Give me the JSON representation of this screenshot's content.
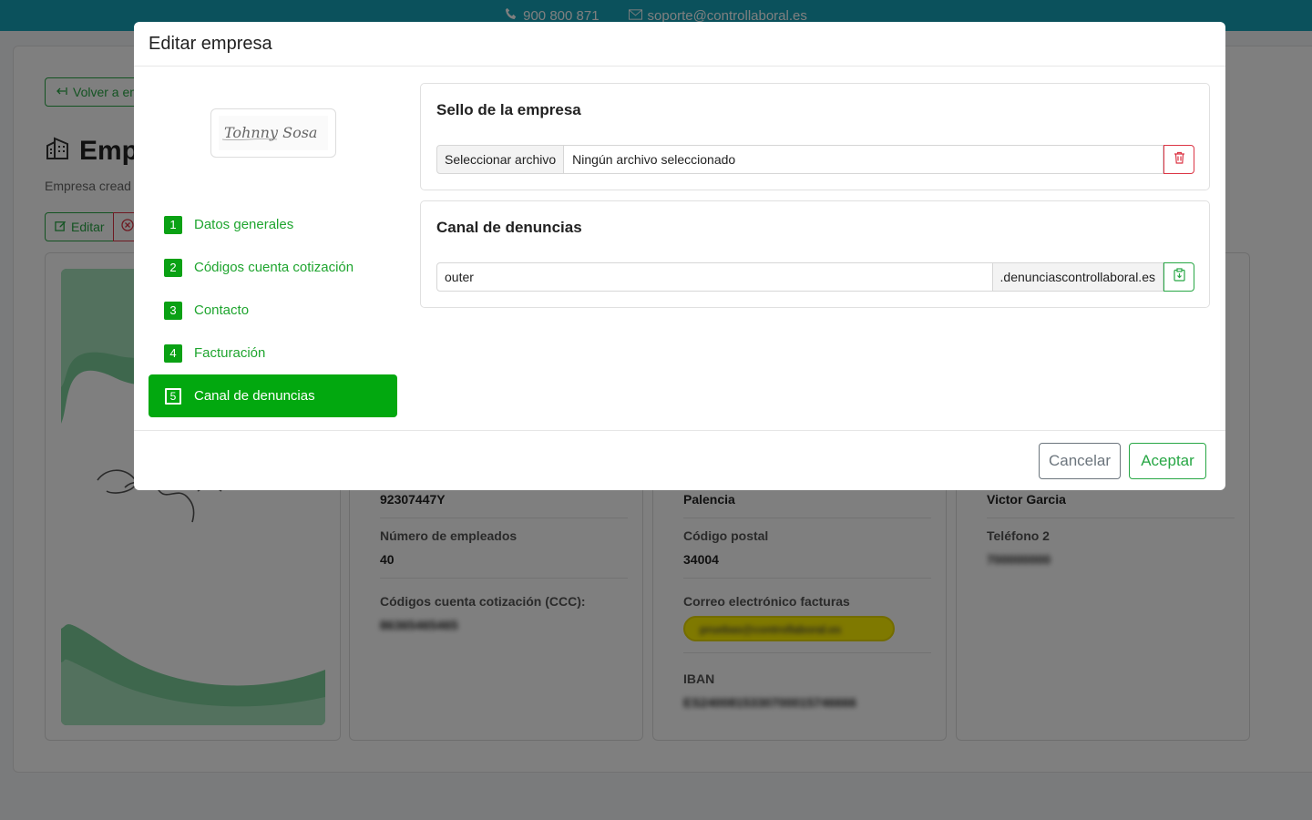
{
  "topbar": {
    "phone": "900 800 871",
    "email": "soporte@controllaboral.es"
  },
  "page": {
    "back_label": "Volver a em",
    "title": "Emp",
    "subtitle": "Empresa cread",
    "edit_label": "Editar"
  },
  "cards": {
    "c2": {
      "nif_value": "92307447Y",
      "employees_label": "Número de empleados",
      "employees_value": "40",
      "ccc_label": "Códigos cuenta cotización (CCC):",
      "ccc_value": "86365465465"
    },
    "c3": {
      "province_value": "Palencia",
      "postal_label": "Código postal",
      "postal_value": "34004",
      "invoice_email_label": "Correo electrónico facturas",
      "invoice_email_value": "pruebas@controllaboral.es",
      "iban_label": "IBAN",
      "iban_value": "ES2400815330700015746666"
    },
    "c4": {
      "contact_value": "Victor Garcia",
      "phone2_label": "Teléfono 2",
      "phone2_value": "700000000"
    }
  },
  "modal": {
    "title": "Editar empresa",
    "logo_text": "Tohnny Sosa",
    "steps": [
      {
        "num": "1",
        "label": "Datos generales",
        "active": false
      },
      {
        "num": "2",
        "label": "Códigos cuenta cotización",
        "active": false
      },
      {
        "num": "3",
        "label": "Contacto",
        "active": false
      },
      {
        "num": "4",
        "label": "Facturación",
        "active": false
      },
      {
        "num": "5",
        "label": "Canal de denuncias",
        "active": true
      }
    ],
    "stamp_section": {
      "title": "Sello de la empresa",
      "file_button": "Seleccionar archivo",
      "file_status": "Ningún archivo seleccionado"
    },
    "channel_section": {
      "title": "Canal de denuncias",
      "subdomain_value": "outer",
      "domain_suffix": ".denunciascontrollaboral.es"
    },
    "footer": {
      "cancel": "Cancelar",
      "accept": "Aceptar"
    }
  },
  "colors": {
    "accent": "#02a80f",
    "danger": "#dc3545",
    "topbar": "#17a2b8"
  }
}
